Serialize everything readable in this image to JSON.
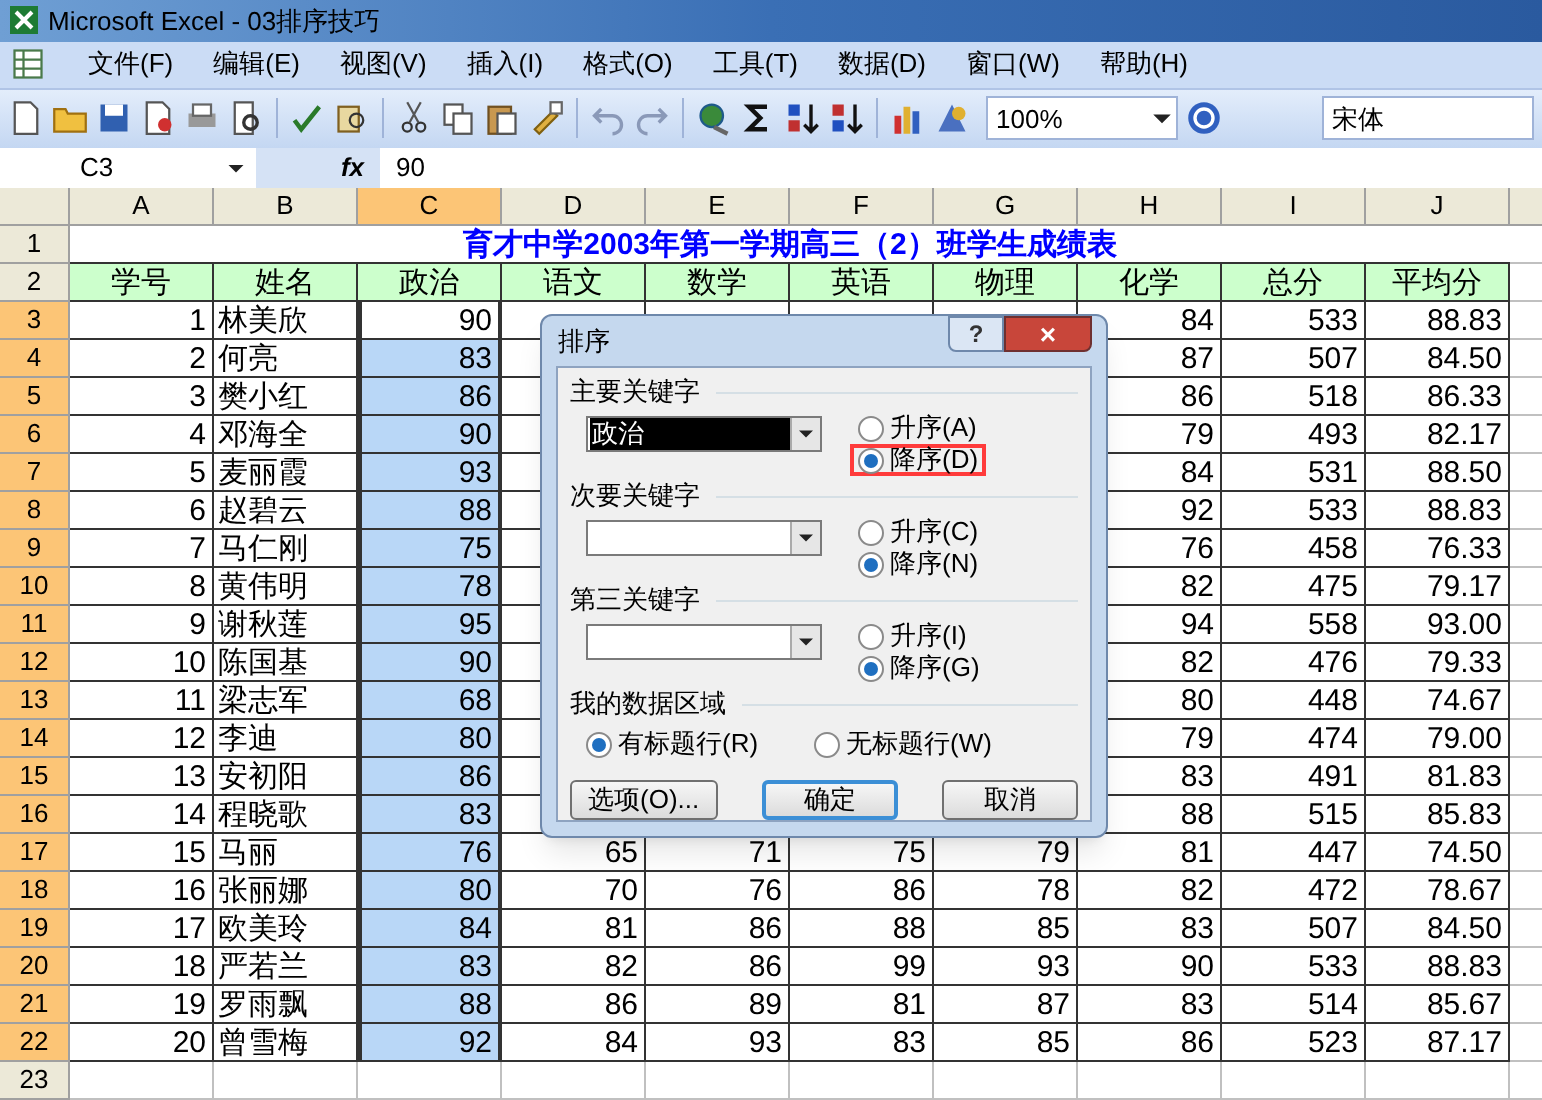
{
  "window": {
    "title": "Microsoft Excel - 03排序技巧"
  },
  "menu": [
    "文件(F)",
    "编辑(E)",
    "视图(V)",
    "插入(I)",
    "格式(O)",
    "工具(T)",
    "数据(D)",
    "窗口(W)",
    "帮助(H)"
  ],
  "toolbar": {
    "zoom": "100%",
    "font": "宋体"
  },
  "formula_bar": {
    "name_box": "C3",
    "fx_label": "fx",
    "value": "90"
  },
  "columns": [
    {
      "letter": "A",
      "selected": false
    },
    {
      "letter": "B",
      "selected": false
    },
    {
      "letter": "C",
      "selected": true
    },
    {
      "letter": "D",
      "selected": false
    },
    {
      "letter": "E",
      "selected": false
    },
    {
      "letter": "F",
      "selected": false
    },
    {
      "letter": "G",
      "selected": false
    },
    {
      "letter": "H",
      "selected": false
    },
    {
      "letter": "I",
      "selected": false
    },
    {
      "letter": "J",
      "selected": false
    }
  ],
  "sheet_title": {
    "header": "1",
    "selected": false,
    "text": "育才中学2003年第一学期高三（2）班学生成绩表"
  },
  "header_row": {
    "header": "2",
    "selected": false,
    "cells": [
      "学号",
      "姓名",
      "政治",
      "语文",
      "数学",
      "英语",
      "物理",
      "化学",
      "总分",
      "平均分"
    ]
  },
  "rows": [
    {
      "header": "3",
      "selected": true,
      "active": true,
      "cells": [
        "1",
        "林美欣",
        "90",
        null,
        null,
        null,
        null,
        "84",
        "533",
        "88.83"
      ]
    },
    {
      "header": "4",
      "selected": true,
      "active": false,
      "cells": [
        "2",
        "何亮",
        "83",
        null,
        null,
        null,
        null,
        "87",
        "507",
        "84.50"
      ]
    },
    {
      "header": "5",
      "selected": true,
      "active": false,
      "cells": [
        "3",
        "樊小红",
        "86",
        null,
        null,
        null,
        null,
        "86",
        "518",
        "86.33"
      ]
    },
    {
      "header": "6",
      "selected": true,
      "active": false,
      "cells": [
        "4",
        "邓海全",
        "90",
        null,
        null,
        null,
        null,
        "79",
        "493",
        "82.17"
      ]
    },
    {
      "header": "7",
      "selected": true,
      "active": false,
      "cells": [
        "5",
        "麦丽霞",
        "93",
        null,
        null,
        null,
        null,
        "84",
        "531",
        "88.50"
      ]
    },
    {
      "header": "8",
      "selected": true,
      "active": false,
      "cells": [
        "6",
        "赵碧云",
        "88",
        null,
        null,
        null,
        null,
        "92",
        "533",
        "88.83"
      ]
    },
    {
      "header": "9",
      "selected": true,
      "active": false,
      "cells": [
        "7",
        "马仁刚",
        "75",
        null,
        null,
        null,
        null,
        "76",
        "458",
        "76.33"
      ]
    },
    {
      "header": "10",
      "selected": true,
      "active": false,
      "cells": [
        "8",
        "黄伟明",
        "78",
        null,
        null,
        null,
        null,
        "82",
        "475",
        "79.17"
      ]
    },
    {
      "header": "11",
      "selected": true,
      "active": false,
      "cells": [
        "9",
        "谢秋莲",
        "95",
        null,
        null,
        null,
        null,
        "94",
        "558",
        "93.00"
      ]
    },
    {
      "header": "12",
      "selected": true,
      "active": false,
      "cells": [
        "10",
        "陈国基",
        "90",
        null,
        null,
        null,
        null,
        "82",
        "476",
        "79.33"
      ]
    },
    {
      "header": "13",
      "selected": true,
      "active": false,
      "cells": [
        "11",
        "梁志军",
        "68",
        null,
        null,
        null,
        null,
        "80",
        "448",
        "74.67"
      ]
    },
    {
      "header": "14",
      "selected": true,
      "active": false,
      "cells": [
        "12",
        "李迪",
        "80",
        null,
        null,
        null,
        null,
        "79",
        "474",
        "79.00"
      ]
    },
    {
      "header": "15",
      "selected": true,
      "active": false,
      "cells": [
        "13",
        "安初阳",
        "86",
        null,
        null,
        null,
        null,
        "83",
        "491",
        "81.83"
      ]
    },
    {
      "header": "16",
      "selected": true,
      "active": false,
      "cells": [
        "14",
        "程晓歌",
        "83",
        null,
        null,
        null,
        null,
        "88",
        "515",
        "85.83"
      ]
    },
    {
      "header": "17",
      "selected": true,
      "active": false,
      "cells": [
        "15",
        "马丽",
        "76",
        "65",
        "71",
        "75",
        "79",
        "81",
        "447",
        "74.50"
      ]
    },
    {
      "header": "18",
      "selected": true,
      "active": false,
      "cells": [
        "16",
        "张丽娜",
        "80",
        "70",
        "76",
        "86",
        "78",
        "82",
        "472",
        "78.67"
      ]
    },
    {
      "header": "19",
      "selected": true,
      "active": false,
      "cells": [
        "17",
        "欧美玲",
        "84",
        "81",
        "86",
        "88",
        "85",
        "83",
        "507",
        "84.50"
      ]
    },
    {
      "header": "20",
      "selected": true,
      "active": false,
      "cells": [
        "18",
        "严若兰",
        "83",
        "82",
        "86",
        "99",
        "93",
        "90",
        "533",
        "88.83"
      ]
    },
    {
      "header": "21",
      "selected": true,
      "active": false,
      "cells": [
        "19",
        "罗雨飘",
        "88",
        "86",
        "89",
        "81",
        "87",
        "83",
        "514",
        "85.67"
      ]
    },
    {
      "header": "22",
      "selected": true,
      "active": false,
      "cells": [
        "20",
        "曾雪梅",
        "92",
        "84",
        "93",
        "83",
        "85",
        "86",
        "523",
        "87.17"
      ]
    },
    {
      "header": "23",
      "selected": false,
      "cells": []
    }
  ],
  "dialog": {
    "title": "排序",
    "help": "?",
    "close": "×",
    "keys": [
      {
        "label": "主要关键字",
        "value": "政治",
        "options": [
          {
            "label": "升序(A)",
            "selected": false,
            "highlighted": false
          },
          {
            "label": "降序(D)",
            "selected": true,
            "highlighted": true
          }
        ]
      },
      {
        "label": "次要关键字",
        "options": [
          {
            "label": "升序(C)",
            "selected": false,
            "highlighted": false
          },
          {
            "label": "降序(N)",
            "selected": true,
            "highlighted": false
          }
        ]
      },
      {
        "label": "第三关键字",
        "options": [
          {
            "label": "升序(I)",
            "selected": false,
            "highlighted": false
          },
          {
            "label": "降序(G)",
            "selected": true,
            "highlighted": false
          }
        ]
      }
    ],
    "range": {
      "label": "我的数据区域",
      "options": [
        {
          "label": "有标题行(R)",
          "selected": true
        },
        {
          "label": "无标题行(W)",
          "selected": false
        }
      ]
    },
    "buttons": [
      {
        "label": "选项(O)...",
        "kind": "normal"
      },
      {
        "label": "确定",
        "kind": "default"
      },
      {
        "label": "取消",
        "kind": "normal"
      }
    ]
  }
}
